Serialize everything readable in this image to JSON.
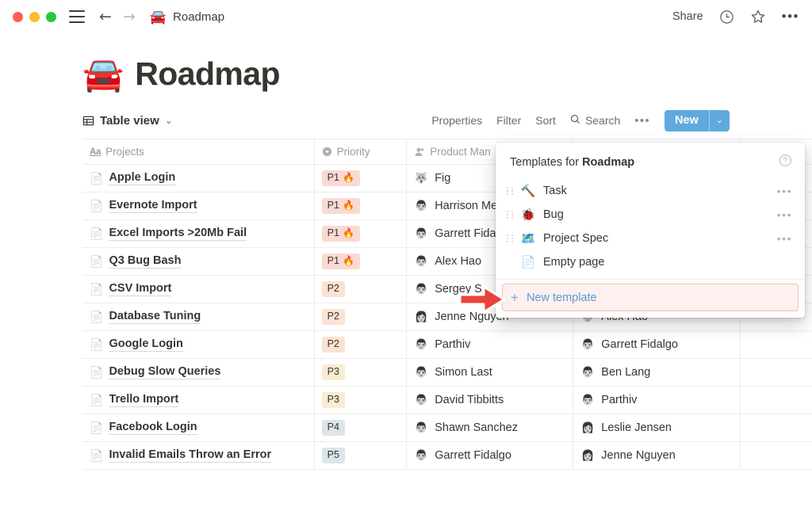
{
  "titlebar": {
    "traffic_lights": [
      "close",
      "minimize",
      "maximize"
    ],
    "menu_icon": "hamburger-icon",
    "back_icon": "←",
    "forward_icon": "→",
    "doc_emoji": "🚘",
    "doc_name": "Roadmap",
    "share_label": "Share",
    "clock_icon": "history-icon",
    "star_icon": "favorite-icon",
    "more_icon": "•••"
  },
  "page": {
    "emoji": "🚘",
    "title": "Roadmap"
  },
  "toolbar": {
    "view_label": "Table view",
    "view_caret": "⌄",
    "properties_label": "Properties",
    "filter_label": "Filter",
    "sort_label": "Sort",
    "search_label": "Search",
    "more_label": "•••",
    "new_label": "New",
    "new_caret": "⌄",
    "new_button_color": "#5fa9dc"
  },
  "table": {
    "columns": [
      {
        "key": "projects",
        "label": "Projects",
        "icon": "text-property-icon"
      },
      {
        "key": "priority",
        "label": "Priority",
        "icon": "select-property-icon"
      },
      {
        "key": "product_manager",
        "label": "Product Man",
        "icon": "person-property-icon"
      },
      {
        "key": "engineering",
        "label": "",
        "icon": ""
      },
      {
        "key": "extra",
        "label": "",
        "icon": ""
      }
    ],
    "priority_colors": {
      "P1": "#fbd9d3",
      "P2": "#fbe2d3",
      "P3": "#f9ecd1",
      "P4": "#dbe5ea",
      "P5": "#dbe5ea"
    },
    "rows": [
      {
        "project": "Apple Login",
        "priority": "P1",
        "fire": "🔥",
        "pm": "Fig",
        "pm_avatar": "🐺",
        "eng": "",
        "eng_avatar": ""
      },
      {
        "project": "Evernote Import",
        "priority": "P1",
        "fire": "🔥",
        "pm": "Harrison Me",
        "pm_avatar": "👨",
        "eng": "",
        "eng_avatar": ""
      },
      {
        "project": "Excel Imports >20Mb Fail",
        "priority": "P1",
        "fire": "🔥",
        "pm": "Garrett Fida",
        "pm_avatar": "👨",
        "eng": "",
        "eng_avatar": ""
      },
      {
        "project": "Q3 Bug Bash",
        "priority": "P1",
        "fire": "🔥",
        "pm": "Alex Hao",
        "pm_avatar": "👨",
        "eng": "",
        "eng_avatar": ""
      },
      {
        "project": "CSV Import",
        "priority": "P2",
        "fire": "",
        "pm": "Sergey S",
        "pm_avatar": "👨",
        "eng": "",
        "eng_avatar": ""
      },
      {
        "project": "Database Tuning",
        "priority": "P2",
        "fire": "",
        "pm": "Jenne Nguyen",
        "pm_avatar": "👩",
        "eng": "Alex Hao",
        "eng_avatar": "👨"
      },
      {
        "project": "Google Login",
        "priority": "P2",
        "fire": "",
        "pm": "Parthiv",
        "pm_avatar": "👨",
        "eng": "Garrett Fidalgo",
        "eng_avatar": "👨"
      },
      {
        "project": "Debug Slow Queries",
        "priority": "P3",
        "fire": "",
        "pm": "Simon Last",
        "pm_avatar": "👨",
        "eng": "Ben Lang",
        "eng_avatar": "👨"
      },
      {
        "project": "Trello Import",
        "priority": "P3",
        "fire": "",
        "pm": "David Tibbitts",
        "pm_avatar": "👨",
        "eng": "Parthiv",
        "eng_avatar": "👨"
      },
      {
        "project": "Facebook Login",
        "priority": "P4",
        "fire": "",
        "pm": "Shawn Sanchez",
        "pm_avatar": "👨",
        "eng": "Leslie Jensen",
        "eng_avatar": "👩"
      },
      {
        "project": "Invalid Emails Throw an Error",
        "priority": "P5",
        "fire": "",
        "pm": "Garrett Fidalgo",
        "pm_avatar": "👨",
        "eng": "Jenne Nguyen",
        "eng_avatar": "👩"
      }
    ]
  },
  "templates_dropdown": {
    "title_prefix": "Templates for ",
    "title_target": "Roadmap",
    "help_icon": "question-mark-icon",
    "items": [
      {
        "emoji": "🔨",
        "label": "Task",
        "draggable": true,
        "menu": "•••"
      },
      {
        "emoji": "🐞",
        "label": "Bug",
        "draggable": true,
        "menu": "•••"
      },
      {
        "emoji": "🗺️",
        "label": "Project Spec",
        "draggable": true,
        "menu": "•••"
      },
      {
        "emoji": "📄",
        "label": "Empty page",
        "draggable": false,
        "menu": ""
      }
    ],
    "new_template": {
      "plus": "+",
      "label": "New template",
      "highlight_border": "#f3bfb6",
      "highlight_fill": "#fdf0ee"
    }
  },
  "annotation": {
    "arrow_color": "#e8433a",
    "points_to": "New template"
  }
}
